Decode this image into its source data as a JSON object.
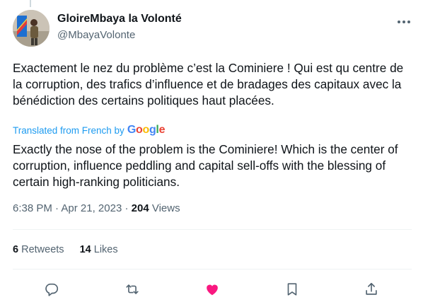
{
  "author": {
    "display_name": "GloireMbaya la Volonté",
    "handle": "@MbayaVolonte",
    "avatar": "avatar-photo-person-with-flag"
  },
  "tweet": {
    "text": "Exactement le nez du problème c’est la Cominiere ! Qui est qu centre de la corruption, des trafics d’influence et de bradages des capitaux avec la bénédiction des certains politiques haut placées.",
    "translated_label": "Translated from French by",
    "translator_brand": "Google",
    "translation": "Exactly the nose of the problem is the Cominiere! Which is the center of corruption, influence peddling and capital sell-offs with the blessing of certain high-ranking politicians."
  },
  "meta": {
    "time": "6:38 PM",
    "separator": " · ",
    "date": "Apr 21, 2023",
    "views_count": "204",
    "views_label": "Views"
  },
  "stats": {
    "retweets_count": "6",
    "retweets_label": "Retweets",
    "likes_count": "14",
    "likes_label": "Likes"
  },
  "actions": [
    {
      "name": "reply",
      "icon": "reply-icon"
    },
    {
      "name": "retweet",
      "icon": "retweet-icon"
    },
    {
      "name": "like",
      "icon": "heart-icon",
      "active": true
    },
    {
      "name": "bookmark",
      "icon": "bookmark-icon"
    },
    {
      "name": "share",
      "icon": "share-icon"
    }
  ],
  "colors": {
    "text": "#0f1419",
    "muted": "#536471",
    "link": "#1d9bf0",
    "like_active": "#f91880",
    "divider": "#eff3f4"
  }
}
